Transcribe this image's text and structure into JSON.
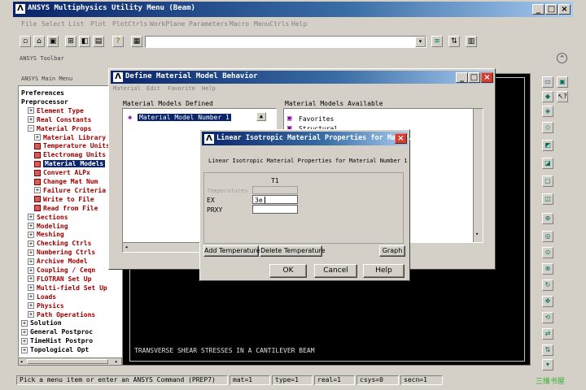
{
  "app": {
    "title": "ANSYS Multiphysics Utility Menu (Beam)",
    "menu": [
      "File",
      "Select",
      "List",
      "Plot",
      "PlotCtrls",
      "WorkPlane",
      "Parameters",
      "Macro",
      "MenuCtrls",
      "Help"
    ],
    "toolbar_label": "ANSYS Toolbar"
  },
  "main_menu": {
    "title": "ANSYS Main Menu",
    "items": [
      {
        "label": "Preferences",
        "marker": "",
        "indent": 0,
        "color": "black"
      },
      {
        "label": "Preprocessor",
        "marker": "",
        "indent": 0,
        "color": "black"
      },
      {
        "label": "Element Type",
        "marker": "+",
        "indent": 1,
        "color": "red"
      },
      {
        "label": "Real Constants",
        "marker": "+",
        "indent": 1,
        "color": "red"
      },
      {
        "label": "Material Props",
        "marker": "-",
        "indent": 1,
        "color": "red"
      },
      {
        "label": "Material Library",
        "marker": "+",
        "indent": 2,
        "color": "red"
      },
      {
        "label": "Temperature Units",
        "marker": "leaf",
        "indent": 2,
        "color": "red"
      },
      {
        "label": "Electromag Units",
        "marker": "leaf",
        "indent": 2,
        "color": "red"
      },
      {
        "label": "Material Models",
        "marker": "leaf",
        "indent": 2,
        "color": "selected"
      },
      {
        "label": "Convert ALPx",
        "marker": "leaf",
        "indent": 2,
        "color": "red"
      },
      {
        "label": "Change Mat Num",
        "marker": "leaf",
        "indent": 2,
        "color": "red"
      },
      {
        "label": "Failure Criteria",
        "marker": "+",
        "indent": 2,
        "color": "red"
      },
      {
        "label": "Write to File",
        "marker": "leaf",
        "indent": 2,
        "color": "red"
      },
      {
        "label": "Read from File",
        "marker": "leaf",
        "indent": 2,
        "color": "red"
      },
      {
        "label": "Sections",
        "marker": "+",
        "indent": 1,
        "color": "red"
      },
      {
        "label": "Modeling",
        "marker": "+",
        "indent": 1,
        "color": "red"
      },
      {
        "label": "Meshing",
        "marker": "+",
        "indent": 1,
        "color": "red"
      },
      {
        "label": "Checking Ctrls",
        "marker": "+",
        "indent": 1,
        "color": "red"
      },
      {
        "label": "Numbering Ctrls",
        "marker": "+",
        "indent": 1,
        "color": "red"
      },
      {
        "label": "Archive Model",
        "marker": "+",
        "indent": 1,
        "color": "red"
      },
      {
        "label": "Coupling / Ceqn",
        "marker": "+",
        "indent": 1,
        "color": "red"
      },
      {
        "label": "FLOTRAN Set Up",
        "marker": "+",
        "indent": 1,
        "color": "red"
      },
      {
        "label": "Multi-field Set Up",
        "marker": "+",
        "indent": 1,
        "color": "red"
      },
      {
        "label": "Loads",
        "marker": "+",
        "indent": 1,
        "color": "red"
      },
      {
        "label": "Physics",
        "marker": "+",
        "indent": 1,
        "color": "red"
      },
      {
        "label": "Path Operations",
        "marker": "+",
        "indent": 1,
        "color": "red"
      },
      {
        "label": "Solution",
        "marker": "+",
        "indent": 0,
        "color": "black"
      },
      {
        "label": "General Postproc",
        "marker": "+",
        "indent": 0,
        "color": "black"
      },
      {
        "label": "TimeHist Postpro",
        "marker": "+",
        "indent": 0,
        "color": "black"
      },
      {
        "label": "Topological Opt",
        "marker": "+",
        "indent": 0,
        "color": "black"
      }
    ]
  },
  "graphics": {
    "caption": "TRANSVERSE SHEAR STRESSES IN A CANTILEVER BEAM"
  },
  "define_dialog": {
    "title": "Define Material Model Behavior",
    "menu": [
      "Material",
      "Edit",
      "Favorite",
      "Help"
    ],
    "defined_label": "Material Models Defined",
    "defined_item": "Material Model Number 1",
    "available_label": "Material Models Available",
    "available_items": [
      "Favorites",
      "Structural"
    ]
  },
  "linear_dialog": {
    "title": "Linear Isotropic Material Properties for Mater...",
    "subtitle": "Linear Isotropic Material Properties for Material Number 1",
    "column_header": "T1",
    "rows": [
      {
        "label": "Temperatures",
        "value": ""
      },
      {
        "label": "EX",
        "value": "3e"
      },
      {
        "label": "PRXY",
        "value": ""
      }
    ],
    "add_temperature": "Add Temperature",
    "delete_temperature": "Delete Temperature",
    "graph": "Graph",
    "ok": "OK",
    "cancel": "Cancel",
    "help": "Help"
  },
  "status_bar": {
    "prompt": "Pick a menu item or enter an ANSYS Command (PREP7)",
    "mat": "mat=1",
    "type": "type=1",
    "real": "real=1",
    "csys": "csys=0",
    "secn": "secn=1"
  },
  "watermark": "三维书屋"
}
